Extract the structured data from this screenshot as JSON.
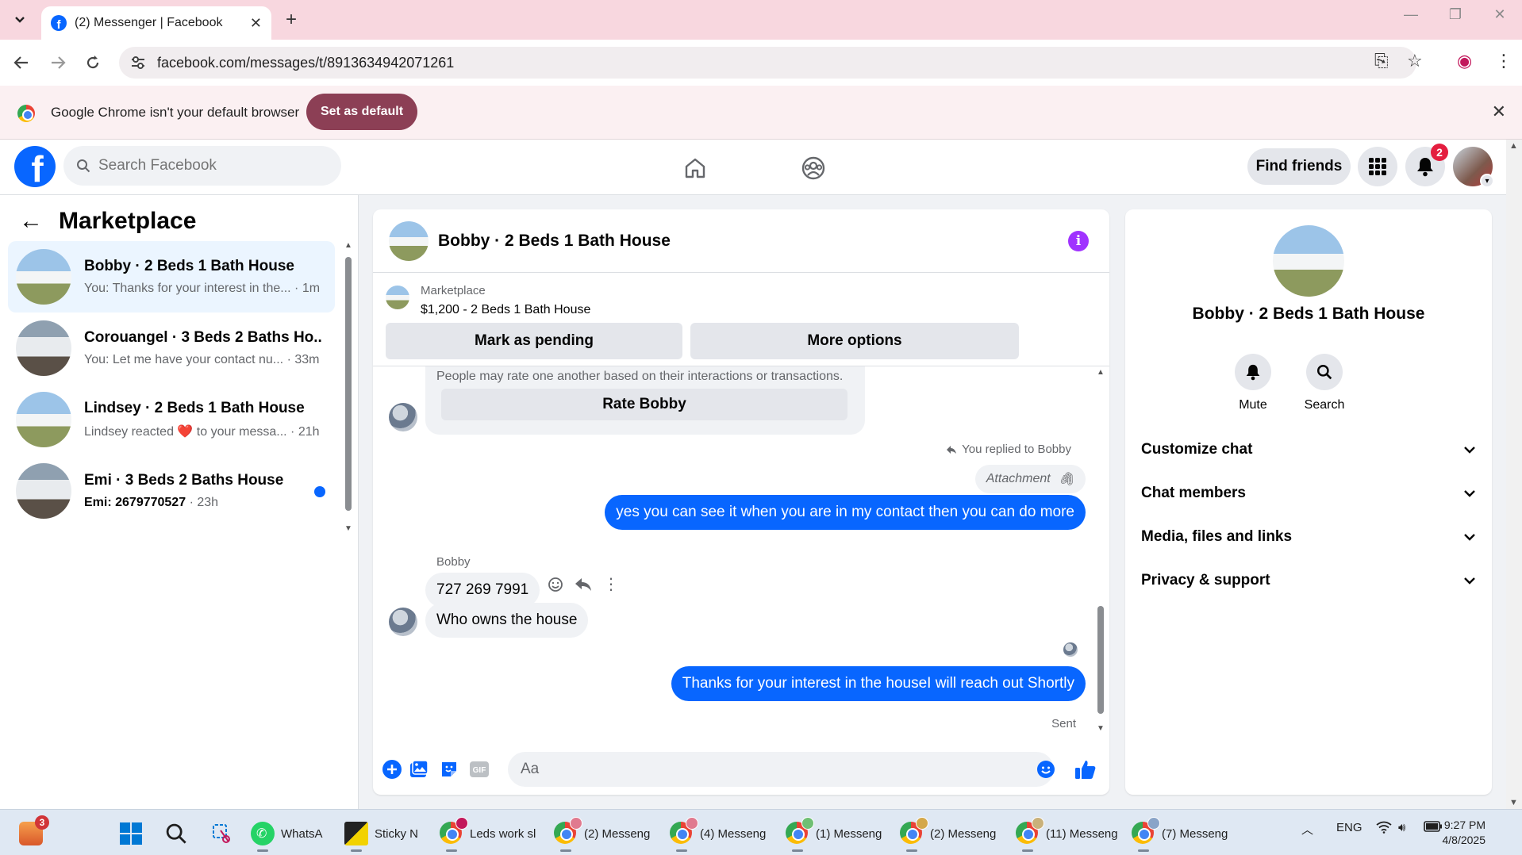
{
  "browser": {
    "tab_title": "(2) Messenger | Facebook",
    "url": "facebook.com/messages/t/8913634942071261",
    "infobar_text": "Google Chrome isn't your default browser",
    "set_default_label": "Set as default"
  },
  "fb_header": {
    "search_placeholder": "Search Facebook",
    "find_friends_label": "Find friends",
    "notification_count": "2"
  },
  "left_panel": {
    "title": "Marketplace",
    "conversations": [
      {
        "name": "Bobby · 2 Beds 1 Bath House",
        "preview": "You: Thanks for your interest in the...",
        "time": "· 1m",
        "active": true,
        "unread": false
      },
      {
        "name": "Corouangel · 3 Beds 2 Baths Ho...",
        "preview": "You: Let me have your contact nu...",
        "time": "· 33m",
        "active": false,
        "unread": false
      },
      {
        "name": "Lindsey · 2 Beds 1 Bath House",
        "preview": "Lindsey reacted ❤️ to your messa...",
        "time": "· 21h",
        "active": false,
        "unread": false
      },
      {
        "name": "Emi · 3 Beds 2 Baths House",
        "preview": "Emi: 2679770527",
        "time": "· 23h",
        "active": false,
        "unread": true
      }
    ]
  },
  "chat": {
    "title": "Bobby · 2 Beds 1 Bath House",
    "marketplace_label": "Marketplace",
    "listing": "$1,200 - 2 Beds 1 Bath House",
    "mark_pending_label": "Mark as pending",
    "more_options_label": "More options",
    "rate_note": "People may rate one another based on their interactions or transactions.",
    "rate_button": "Rate Bobby",
    "reply_note": "You replied to Bobby",
    "attachment_label": "Attachment",
    "msg_out_1": "yes you can see it when you are in my contact then you can do more",
    "sender": "Bobby",
    "msg_in_1": "727 269 7991",
    "msg_in_2": "Who owns the house",
    "msg_out_2": "Thanks for your interest in the houseI will reach out Shortly",
    "sent_label": "Sent",
    "composer_placeholder": "Aa"
  },
  "details": {
    "name": "Bobby · 2 Beds 1 Bath House",
    "mute_label": "Mute",
    "search_label": "Search",
    "sections": [
      "Customize chat",
      "Chat members",
      "Media, files and links",
      "Privacy & support"
    ]
  },
  "taskbar": {
    "start_badge": "3",
    "apps": [
      {
        "label": "WhatsA",
        "icon": "whatsapp-icon"
      },
      {
        "label": "Sticky N",
        "icon": "sticky-notes-icon"
      },
      {
        "label": "Leds work sl",
        "icon": "chrome-icon"
      },
      {
        "label": "(2) Messeng",
        "icon": "chrome-icon"
      },
      {
        "label": "(4) Messeng",
        "icon": "chrome-icon"
      },
      {
        "label": "(1) Messeng",
        "icon": "chrome-icon"
      },
      {
        "label": "(2) Messeng",
        "icon": "chrome-icon"
      },
      {
        "label": "(11) Messeng",
        "icon": "chrome-icon"
      },
      {
        "label": "(7) Messeng",
        "icon": "chrome-icon"
      }
    ],
    "language": "ENG",
    "time": "9:27 PM",
    "date": "4/8/2025"
  },
  "colors": {
    "fb_blue": "#0866ff",
    "tabstrip_pink": "#f8d7df",
    "set_default_button": "#8c3f55",
    "info_purple": "#a033ff"
  }
}
